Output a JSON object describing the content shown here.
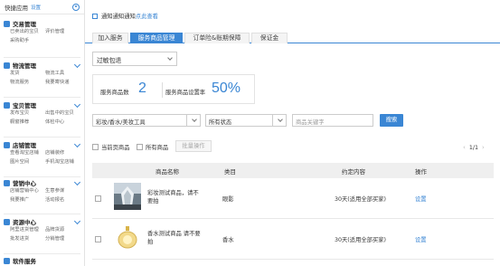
{
  "sidebar": {
    "title": "快捷应用",
    "settings_link": "设置",
    "sections": [
      {
        "name": "交易管理",
        "items": [
          "已卖出的宝贝",
          "评价管理",
          "采购助手"
        ]
      },
      {
        "name": "物流管理",
        "items": [
          "发货",
          "物流工具",
          "物流服务",
          "我要寄快递"
        ]
      },
      {
        "name": "宝贝管理",
        "items": [
          "发布宝贝",
          "出售中的宝贝",
          "橱窗推荐",
          "体检中心"
        ]
      },
      {
        "name": "店铺管理",
        "items": [
          "查看淘宝店铺",
          "店铺装修",
          "图片空间",
          "手机淘宝店铺"
        ]
      },
      {
        "name": "营销中心",
        "items": [
          "店铺营销中心",
          "生意参谋",
          "我要推广",
          "活动报名"
        ]
      },
      {
        "name": "资源中心",
        "items": [
          "阿里进货管理",
          "品牌货源",
          "批发进货",
          "分销管理"
        ]
      },
      {
        "name": "软件服务",
        "items": []
      }
    ]
  },
  "notice": {
    "text": "通知通知通知",
    "link": "点此查看"
  },
  "tabs": [
    "加入服务",
    "服务商品管理",
    "订单险&账期保障",
    "保证金"
  ],
  "active_tab": 1,
  "service_select": {
    "value": "过敏包退"
  },
  "stats": {
    "count_label": "服务商品数",
    "count_value": "2",
    "rate_label": "服务商品设置率",
    "rate_value": "50%"
  },
  "filters": {
    "category": "彩妆/香水/美妆工具",
    "status": "所有状态",
    "keyword_placeholder": "商品关键字",
    "search_label": "搜索"
  },
  "bulk": {
    "current_page_label": "当前页商品",
    "all_label": "所有商品",
    "batch_button": "批量操作"
  },
  "pager": {
    "prev": "‹",
    "current": "1/1",
    "next": "›"
  },
  "table": {
    "headers": [
      "商品名称",
      "类目",
      "约定内容",
      "操作"
    ],
    "rows": [
      {
        "name": "彩妆测试商品，请不要拍",
        "category": "眼影",
        "contract": "30天(适用全部买家)",
        "action": "设置",
        "thumb_icon": "product-thumb-eyeshadow"
      },
      {
        "name": "香水测试商品 请不要拍",
        "category": "香水",
        "contract": "30天(适用全部买家)",
        "action": "设置",
        "thumb_icon": "product-thumb-perfume"
      }
    ]
  },
  "colors": {
    "accent": "#3a86d4"
  }
}
